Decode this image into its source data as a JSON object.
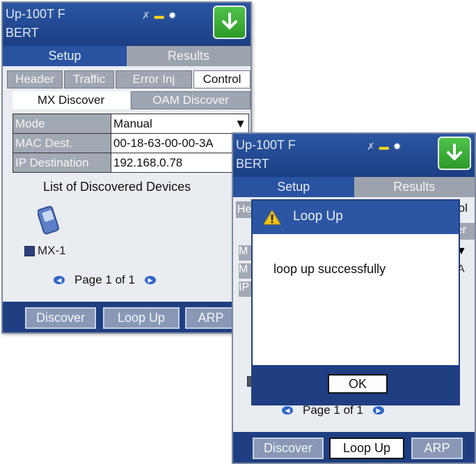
{
  "screen1": {
    "title_line1": "Up-100T F",
    "title_line2": "BERT",
    "icons": [
      "signal-icon",
      "battery-icon",
      "gear-icon",
      "download-icon"
    ],
    "tabs": [
      {
        "label": "Setup"
      },
      {
        "label": "Results"
      }
    ],
    "subtabs": [
      {
        "label": "Header"
      },
      {
        "label": "Traffic"
      },
      {
        "label": "Error Inj"
      },
      {
        "label": "Control"
      }
    ],
    "discover_tabs": [
      {
        "label": "MX Discover"
      },
      {
        "label": "OAM Discover"
      }
    ],
    "fields": [
      {
        "label": "Mode",
        "value": "Manual"
      },
      {
        "label": "MAC Dest.",
        "value": "00-18-63-00-00-3A"
      },
      {
        "label": "IP Destination",
        "value": "192.168.0.78"
      }
    ],
    "list_title": "List of Discovered Devices",
    "device_label": "MX-1",
    "pager": "Page 1 of 1",
    "buttons": [
      {
        "label": "Discover"
      },
      {
        "label": "Loop Up"
      },
      {
        "label": "ARP"
      }
    ]
  },
  "screen2": {
    "title_line1": "Up-100T F",
    "title_line2": "BERT",
    "tabs": [
      {
        "label": "Setup"
      },
      {
        "label": "Results"
      }
    ],
    "partial_left_1": "He",
    "partial_right_1": "rol",
    "partial_right_2": "er",
    "partial_left_3": "M",
    "partial_left_4": "M",
    "partial_left_5": "IP",
    "partial_right_5": "A",
    "pager": "Page 1 of 1",
    "dialog": {
      "title": "Loop Up",
      "message": "loop up successfully",
      "ok_label": "OK"
    },
    "buttons": [
      {
        "label": "Discover"
      },
      {
        "label": "Loop Up"
      },
      {
        "label": "ARP"
      }
    ]
  },
  "colors": {
    "title_blue": "#2c56a3",
    "bar_navy": "#1f3f82",
    "tab_gray": "#9da3ad",
    "download_green": "#3aaa35",
    "warning_yellow": "#f2c418"
  }
}
